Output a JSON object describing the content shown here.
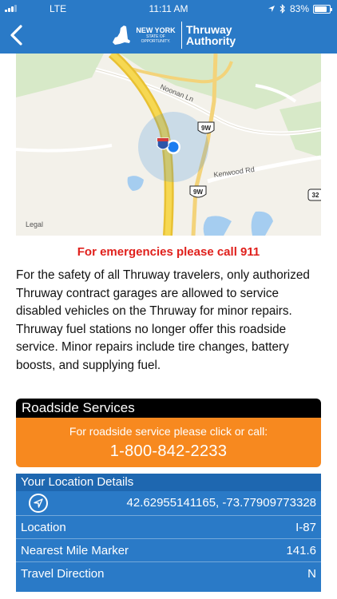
{
  "status_bar": {
    "carrier": "LTE",
    "time": "11:11 AM",
    "battery": "83%",
    "battery_level": 0.83
  },
  "header": {
    "logo_state_line1": "NEW YORK",
    "logo_state_line2": "STATE OF",
    "logo_state_line3": "OPPORTUNITY.",
    "logo_authority_line1": "Thruway",
    "logo_authority_line2": "Authority"
  },
  "map": {
    "road_labels": [
      "Noonan Ln",
      "Kenwood Rd"
    ],
    "shields": [
      "9W",
      "9W",
      "32"
    ],
    "legal": "Legal"
  },
  "emergency": "For emergencies please call 911",
  "description": "For the safety of all Thruway travelers, only authorized Thruway contract garages are allowed to service disabled vehicles on the Thruway for minor repairs. Thruway fuel stations no longer offer this roadside service. Minor repairs include tire changes, battery boosts, and supplying fuel.",
  "roadside": {
    "title": "Roadside Services",
    "prompt": "For roadside service please click or call:",
    "phone": "1-800-842-2233"
  },
  "location_details": {
    "title": "Your Location Details",
    "coordinates": "42.62955141165, -73.77909773328",
    "rows": [
      {
        "label": "Location",
        "value": "I-87"
      },
      {
        "label": "Nearest Mile Marker",
        "value": "141.6"
      },
      {
        "label": "Travel Direction",
        "value": "N"
      }
    ]
  },
  "colors": {
    "header_blue": "#2a7ac7",
    "emergency_red": "#e0201c",
    "call_orange": "#f7891f"
  }
}
